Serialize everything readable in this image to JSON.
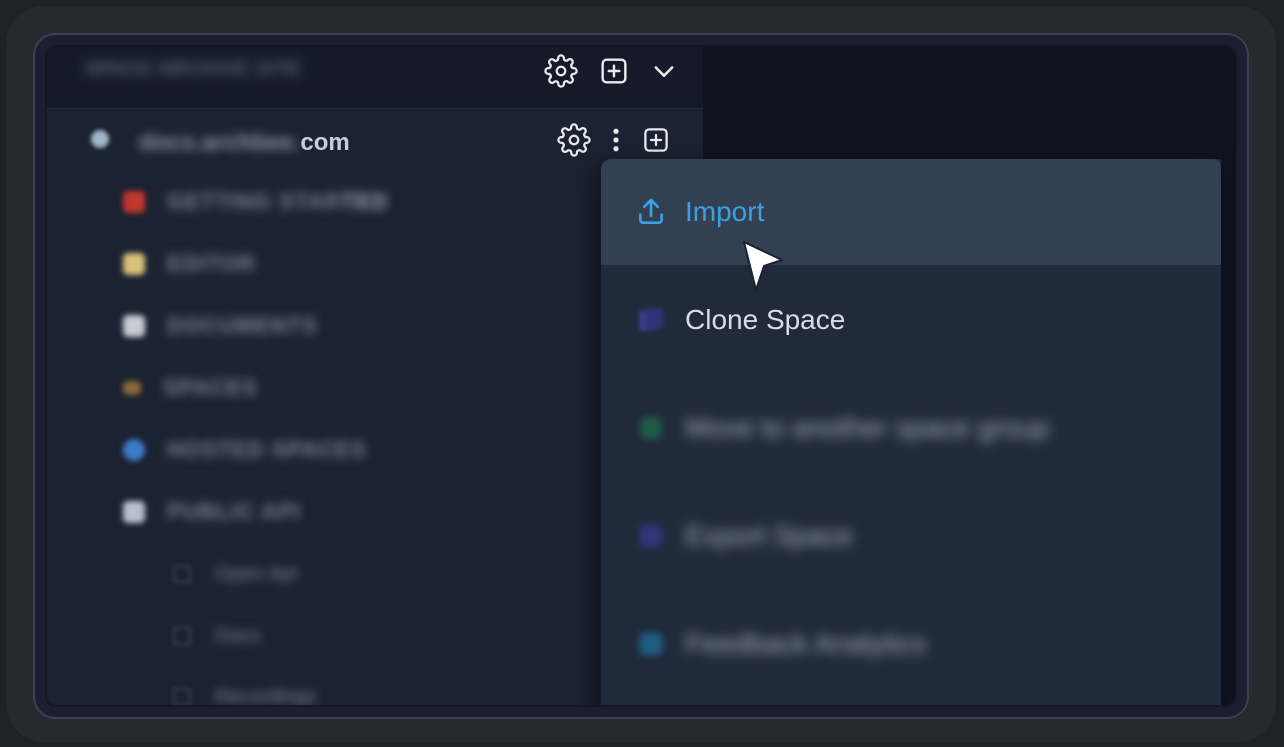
{
  "sidebar": {
    "workspace_name": "SPACE ARCHIVE SITE",
    "space_name_blurred": "docs.archbee.",
    "space_name_suffix": "com",
    "nav": [
      {
        "label_blurred": "GETTING STAR",
        "label_sharp": "TED",
        "color": "#c0392b"
      },
      {
        "label_blurred": "EDITOR",
        "label_sharp": "",
        "color": "#d9c27a"
      },
      {
        "label_blurred": "DOCUMENTS",
        "label_sharp": "",
        "color": "#c9ccd4"
      },
      {
        "label_blurred": "SPACES",
        "label_sharp": "",
        "color": "#8a6b3a"
      },
      {
        "label_blurred": "HOSTED SPACES",
        "label_sharp": "",
        "color": "#3d7cc9"
      },
      {
        "label_blurred": "PUBLIC API",
        "label_sharp": "",
        "color": "#b6c0d0"
      }
    ],
    "sub_items": [
      {
        "label": "Open Api"
      },
      {
        "label": "Docs"
      },
      {
        "label": "Recordings"
      }
    ]
  },
  "menu": {
    "items": [
      {
        "label": "Import",
        "icon": "upload-icon",
        "color": "#3aa1e6"
      },
      {
        "label": "Clone Space",
        "icon": "copy-icon",
        "color": "#3b3f8f"
      },
      {
        "label": "Move to another space group",
        "icon": "move-icon",
        "color": "#1f5e4a"
      },
      {
        "label": "Export Space",
        "icon": "export-icon",
        "color": "#33357a"
      },
      {
        "label": "Feedback Analytics",
        "icon": "analytics-icon",
        "color": "#1f5f86"
      }
    ]
  }
}
